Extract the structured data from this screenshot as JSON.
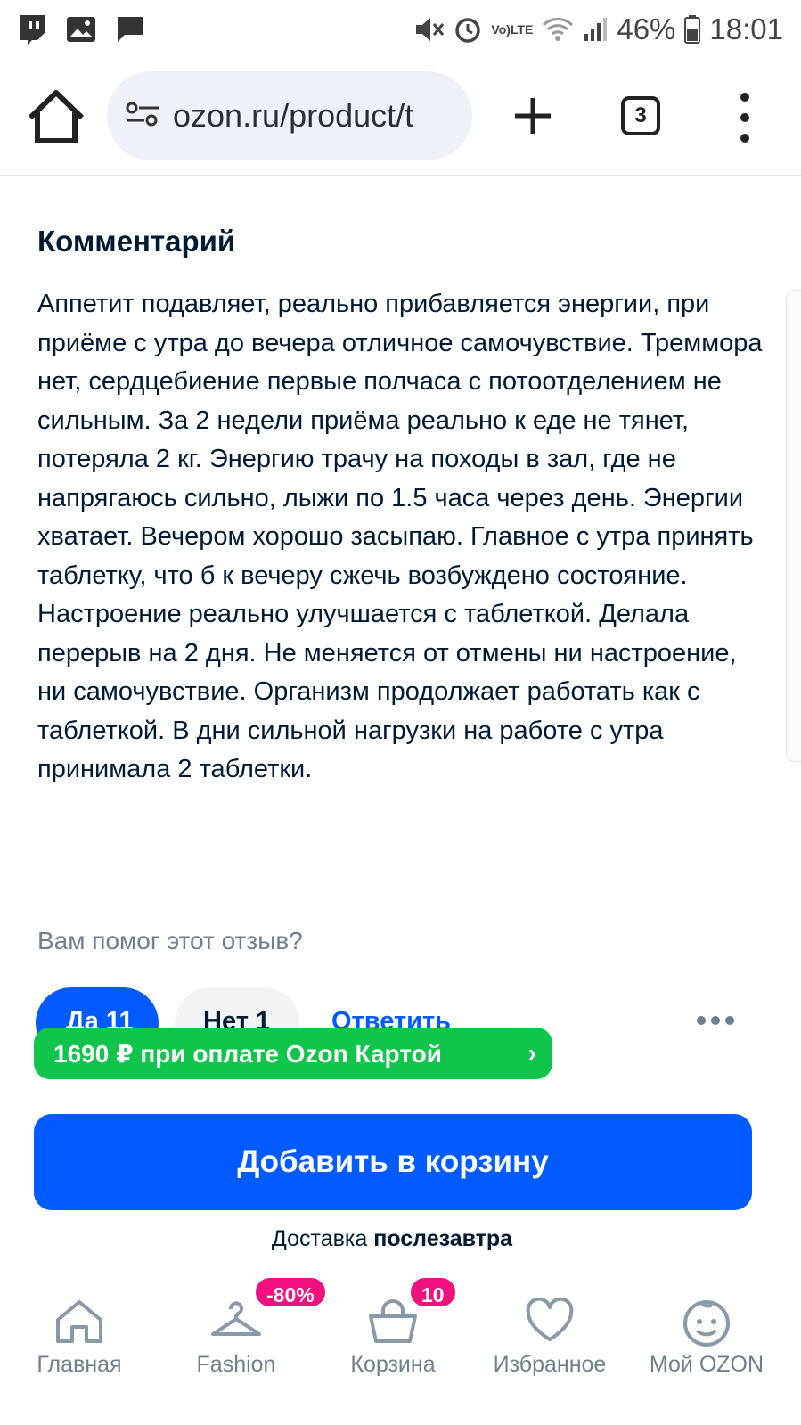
{
  "status_bar": {
    "battery": "46%",
    "time": "18:01",
    "network": "LTE",
    "icons": [
      "twitch-icon",
      "gallery-icon",
      "chat-icon",
      "mute-icon",
      "alarm-icon",
      "volte-icon",
      "wifi-icon",
      "signal-icon",
      "battery-icon"
    ]
  },
  "browser": {
    "url": "ozon.ru/product/t",
    "tab_count": "3"
  },
  "review": {
    "title": "Комментарий",
    "body": "Аппетит подавляет, реально прибавляется энергии, при приёме с утра до вечера отличное самочувствие. Треммора нет, сердцебиение первые полчаса с потоотделением не сильным. За 2 недели приёма реально к еде не тянет, потеряла 2 кг. Энергию трачу на походы в зал, где не напрягаюсь сильно, лыжи по 1.5 часа через день. Энергии хватает. Вечером хорошо засыпаю. Главное с утра принять таблетку, что б к вечеру сжечь возбуждено состояние. Настроение реально улучшается с таблеткой. Делала перерыв на 2 дня. Не меняется от отмены ни настроение, ни самочувствие. Организм продолжает работать как с таблеткой. В дни сильной нагрузки на работе с утра принимала 2 таблетки.",
    "helpful_question": "Вам помог этот отзыв?",
    "yes_label": "Да 11",
    "no_label": "Нет 1",
    "reply_label": "Ответить"
  },
  "promo": {
    "label": "1690 ₽ при оплате Ozon Картой",
    "chevron": "›",
    "color": "#10c44c"
  },
  "cart_button": {
    "label": "Добавить в корзину",
    "color": "#005bff"
  },
  "delivery": {
    "prefix": "Доставка ",
    "when": "послезавтра"
  },
  "bottom_nav": {
    "home": "Главная",
    "fashion": "Fashion",
    "fashion_badge": "-80%",
    "cart": "Корзина",
    "cart_badge": "10",
    "favorites": "Избранное",
    "my_ozon": "Мой OZON",
    "badge_color": "#f1117e"
  }
}
